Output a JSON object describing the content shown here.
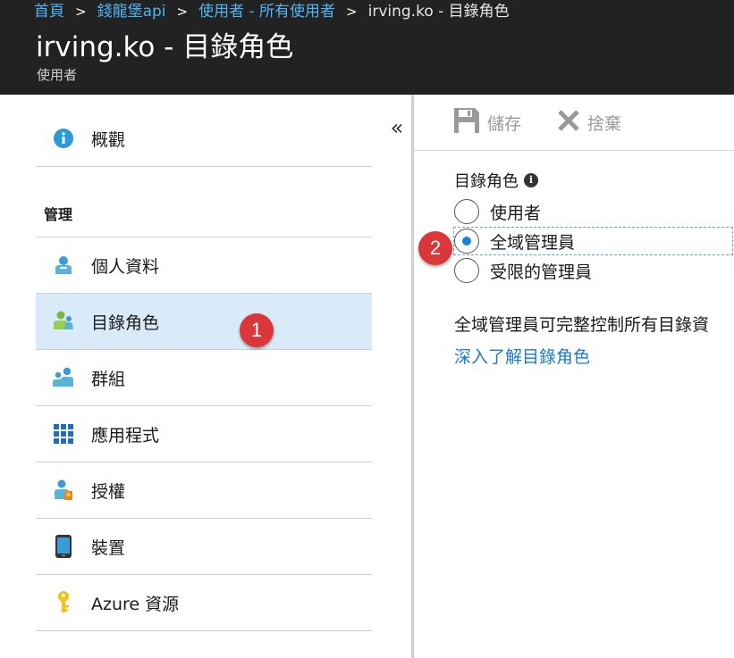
{
  "breadcrumb": {
    "items": [
      "首頁",
      "錢龍堡api",
      "使用者 - 所有使用者"
    ],
    "separator": ">",
    "current": "irving.ko - 目錄角色"
  },
  "header": {
    "title": "irving.ko - 目錄角色",
    "subtitle": "使用者"
  },
  "sidebar": {
    "collapse_glyph": "«",
    "overview_label": "概觀",
    "section_label": "管理",
    "items": [
      {
        "label": "個人資料",
        "icon": "user-profile-icon"
      },
      {
        "label": "目錄角色",
        "icon": "directory-role-icon",
        "active": true
      },
      {
        "label": "群組",
        "icon": "group-icon"
      },
      {
        "label": "應用程式",
        "icon": "apps-grid-icon"
      },
      {
        "label": "授權",
        "icon": "license-icon"
      },
      {
        "label": "裝置",
        "icon": "device-icon"
      },
      {
        "label": "Azure 資源",
        "icon": "key-icon"
      }
    ]
  },
  "toolbar": {
    "save_label": "儲存",
    "discard_label": "捨棄"
  },
  "form": {
    "field_label": "目錄角色",
    "options": [
      {
        "label": "使用者",
        "checked": false
      },
      {
        "label": "全域管理員",
        "checked": true
      },
      {
        "label": "受限的管理員",
        "checked": false
      }
    ],
    "description": "全域管理員可完整控制所有目錄資",
    "learn_more_link": "深入了解目錄角色"
  },
  "annotations": {
    "badge_1": "1",
    "badge_2": "2"
  },
  "colors": {
    "header_bg": "#222222",
    "link": "#1e7bc4",
    "breadcrumb_link": "#4fb3f5",
    "active_nav_bg": "#d9eaf9",
    "radio_checked": "#1a82d8",
    "badge": "#d9373a"
  }
}
